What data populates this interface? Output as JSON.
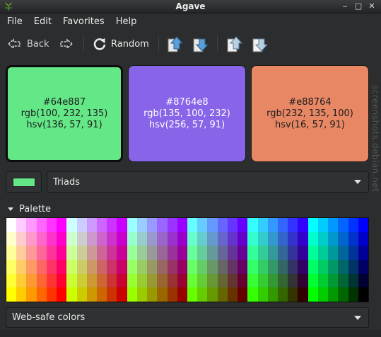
{
  "window": {
    "title": "Agave"
  },
  "menu": [
    "File",
    "Edit",
    "Favorites",
    "Help"
  ],
  "toolbar": {
    "back_label": "Back",
    "random_label": "Random"
  },
  "swatches": [
    {
      "hex": "#64e887",
      "rgb": "rgb(100, 232, 135)",
      "hsv": "hsv(136, 57, 91)",
      "color": "#64e887",
      "selected": true
    },
    {
      "hex": "#8764e8",
      "rgb": "rgb(135, 100, 232)",
      "hsv": "hsv(256, 57, 91)",
      "color": "#8764e8",
      "selected": false
    },
    {
      "hex": "#e88764",
      "rgb": "rgb(232, 135, 100)",
      "hsv": "hsv(16, 57, 91)",
      "color": "#e88764",
      "selected": false
    }
  ],
  "scheme": {
    "value": "Triads",
    "chip_color": "#64e887"
  },
  "palette": {
    "label": "Palette",
    "selector_value": "Web-safe colors"
  },
  "watermark": "screenshots.debian.net",
  "colors": {
    "background": "#2b2d2e",
    "control": "#2f3132",
    "text": "#e6e6e6"
  }
}
